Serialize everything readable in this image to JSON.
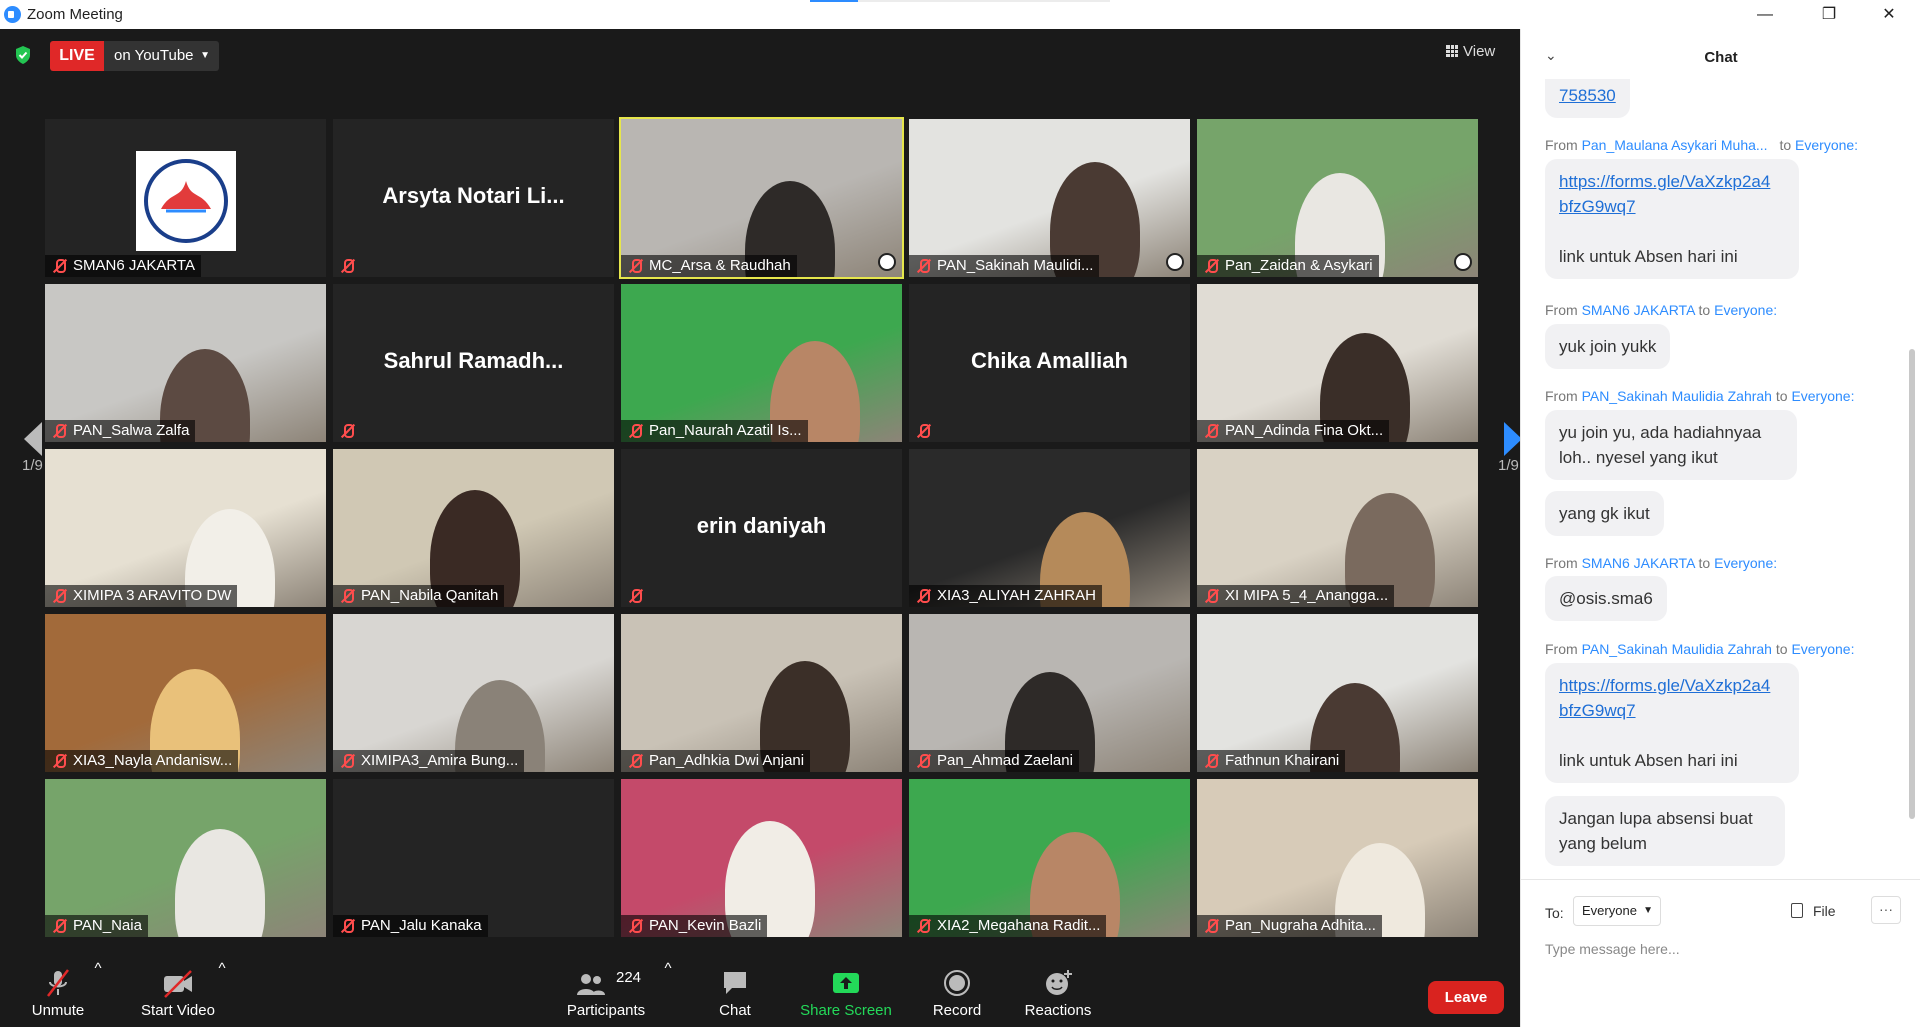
{
  "window": {
    "title": "Zoom Meeting",
    "progress": 0.16,
    "controls": [
      "—",
      "❐",
      "✕"
    ]
  },
  "meeting": {
    "live_badge": "LIVE",
    "stream_target": "on YouTube",
    "view_label": "View",
    "page_indicator_left": "1/9",
    "page_indicator_right": "1/9"
  },
  "tiles": [
    {
      "name": "SMAN6 JAKARTA",
      "big": "",
      "kind": "logo"
    },
    {
      "name": "",
      "big": "Arsyta  Notari  Li...",
      "kind": "name"
    },
    {
      "name": "MC_Arsa & Raudhah",
      "big": "",
      "kind": "video",
      "active": true
    },
    {
      "name": "PAN_Sakinah Maulidi...",
      "big": "",
      "kind": "video"
    },
    {
      "name": "Pan_Zaidan & Asykari",
      "big": "",
      "kind": "video"
    },
    {
      "name": "PAN_Salwa Zalfa",
      "big": "",
      "kind": "video"
    },
    {
      "name": "",
      "big": "Sahrul  Ramadh...",
      "kind": "name"
    },
    {
      "name": "Pan_Naurah Azatil Is...",
      "big": "",
      "kind": "video"
    },
    {
      "name": "",
      "big": "Chika Amalliah",
      "kind": "name"
    },
    {
      "name": "PAN_Adinda Fina Okt...",
      "big": "",
      "kind": "video"
    },
    {
      "name": "XIMIPA 3 ARAVITO DW",
      "big": "",
      "kind": "video"
    },
    {
      "name": "PAN_Nabila Qanitah",
      "big": "",
      "kind": "video"
    },
    {
      "name": "",
      "big": "erin daniyah",
      "kind": "name"
    },
    {
      "name": "XIA3_ALIYAH ZAHRAH",
      "big": "",
      "kind": "video"
    },
    {
      "name": "XI MIPA 5_4_Anangga...",
      "big": "",
      "kind": "video"
    },
    {
      "name": "XIA3_Nayla Andanisw...",
      "big": "",
      "kind": "video"
    },
    {
      "name": "XIMIPA3_Amira Bung...",
      "big": "",
      "kind": "video"
    },
    {
      "name": "Pan_Adhkia Dwi Anjani",
      "big": "",
      "kind": "video"
    },
    {
      "name": "Pan_Ahmad Zaelani",
      "big": "",
      "kind": "video"
    },
    {
      "name": "Fathnun Khairani",
      "big": "",
      "kind": "video"
    },
    {
      "name": "PAN_Naia",
      "big": "",
      "kind": "video"
    },
    {
      "name": "PAN_Jalu Kanaka",
      "big": "",
      "kind": "blank"
    },
    {
      "name": "PAN_Kevin Bazli",
      "big": "",
      "kind": "video"
    },
    {
      "name": "XIA2_Megahana Radit...",
      "big": "",
      "kind": "video"
    },
    {
      "name": "Pan_Nugraha Adhita...",
      "big": "",
      "kind": "video"
    }
  ],
  "toolbar": {
    "unmute": "Unmute",
    "start_video": "Start Video",
    "participants": "Participants",
    "participant_count": "224",
    "chat": "Chat",
    "share_screen": "Share Screen",
    "record": "Record",
    "reactions": "Reactions",
    "leave": "Leave"
  },
  "chat": {
    "title": "Chat",
    "messages_top_fragment": "758530",
    "from_word": "From",
    "to_word": "to",
    "recipient": "Everyone:",
    "messages": [
      {
        "sender": "Pan_Maulana Asykari Muha...",
        "lines": [
          "https://forms.gle/VaXzkp2a4",
          "bfzG9wq7",
          "",
          "link untuk Absen hari ini"
        ],
        "link": true
      },
      {
        "sender": "SMAN6 JAKARTA",
        "lines": [
          "yuk join yukk"
        ]
      },
      {
        "sender": "PAN_Sakinah Maulidia Zahrah",
        "lines": [
          "yu join yu, ada hadiahnyaa",
          "loh.. nyesel yang ikut"
        ],
        "extra": "yang gk ikut"
      },
      {
        "sender": "SMAN6 JAKARTA",
        "lines": [
          "@osis.sma6"
        ]
      },
      {
        "sender": "PAN_Sakinah Maulidia Zahrah",
        "lines": [
          "https://forms.gle/VaXzkp2a4",
          "bfzG9wq7",
          "",
          "link untuk Absen hari ini"
        ],
        "link": true,
        "extra": "Jangan lupa absensi buat yang belum"
      }
    ],
    "to_label": "To:",
    "to_value": "Everyone",
    "file_label": "File",
    "more_label": "···",
    "input_placeholder": "Type message here..."
  },
  "colors": {
    "accent": "#2d8cff",
    "live": "#e02828",
    "leave": "#d9231f",
    "share": "#23d959",
    "active_speaker": "#e6e64c"
  }
}
